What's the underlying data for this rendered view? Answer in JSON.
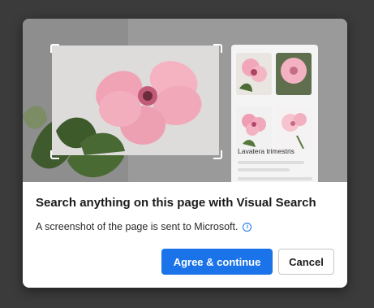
{
  "dialog": {
    "title": "Search anything on this page with Visual Search",
    "description": "A screenshot of the page is sent to Microsoft.",
    "info_icon": "info-icon",
    "primary_button": "Agree & continue",
    "secondary_button": "Cancel"
  },
  "illustration": {
    "result_title": "Lavatera trimestris",
    "thumbnail_icons": [
      "flower-photo",
      "flower-photo",
      "flower-photo",
      "flower-photo"
    ]
  },
  "colors": {
    "accent": "#1a73e8",
    "backdrop": "#3b3b3b",
    "flower": "#f2a7b8"
  }
}
